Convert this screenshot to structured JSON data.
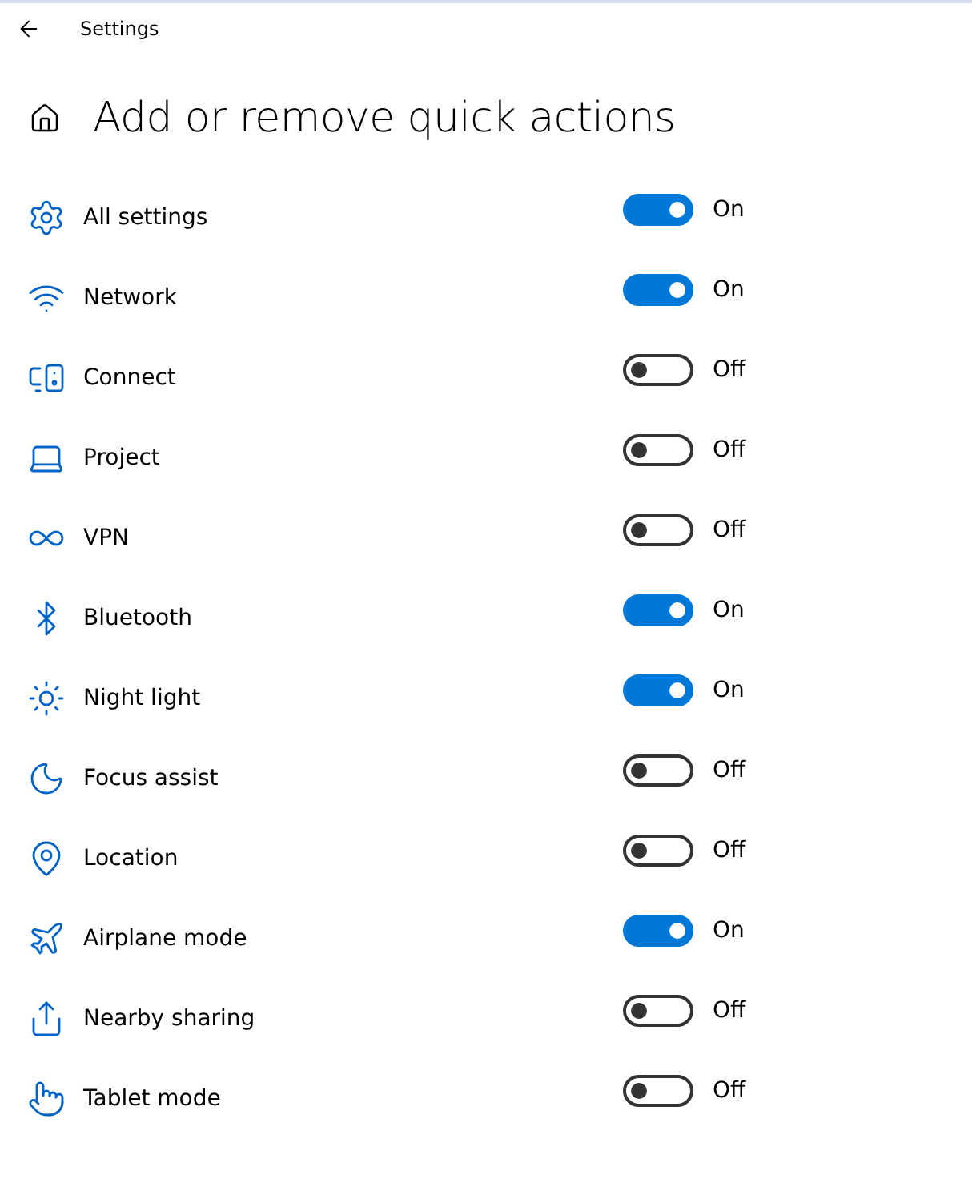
{
  "window": {
    "title": "Settings"
  },
  "page": {
    "title": "Add or remove quick actions"
  },
  "actions": [
    {
      "label": "All settings",
      "on": true,
      "state_label": "On"
    },
    {
      "label": "Network",
      "on": true,
      "state_label": "On"
    },
    {
      "label": "Connect",
      "on": false,
      "state_label": "Off"
    },
    {
      "label": "Project",
      "on": false,
      "state_label": "Off"
    },
    {
      "label": "VPN",
      "on": false,
      "state_label": "Off"
    },
    {
      "label": "Bluetooth",
      "on": true,
      "state_label": "On"
    },
    {
      "label": "Night light",
      "on": true,
      "state_label": "On"
    },
    {
      "label": "Focus assist",
      "on": false,
      "state_label": "Off"
    },
    {
      "label": "Location",
      "on": false,
      "state_label": "Off"
    },
    {
      "label": "Airplane mode",
      "on": true,
      "state_label": "On"
    },
    {
      "label": "Nearby sharing",
      "on": false,
      "state_label": "Off"
    },
    {
      "label": "Tablet mode",
      "on": false,
      "state_label": "Off"
    }
  ]
}
